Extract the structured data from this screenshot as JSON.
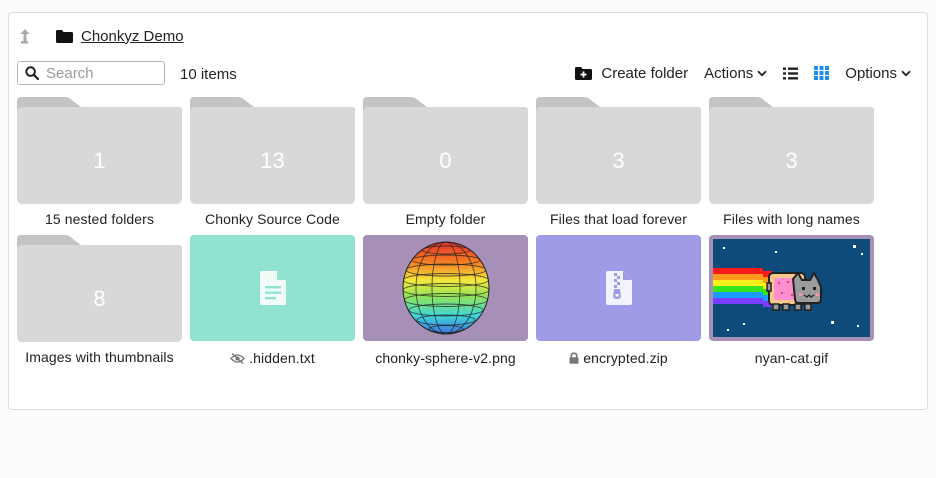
{
  "breadcrumb": {
    "label": "Chonkyz Demo"
  },
  "search": {
    "placeholder": "Search"
  },
  "item_count": "10 items",
  "toolbar": {
    "create_folder_label": "Create folder",
    "actions_label": "Actions",
    "options_label": "Options"
  },
  "colors": {
    "folder": "#d8d8d8",
    "txt_card": "#8fe3cf",
    "png_card": "#a690b8",
    "zip_card": "#9f9be6",
    "gif_card": "#a690b8",
    "grid_view_active": "#1f8eea"
  },
  "folders": [
    {
      "count": "1",
      "name": "15 nested folders"
    },
    {
      "count": "13",
      "name": "Chonky Source Code"
    },
    {
      "count": "0",
      "name": "Empty folder"
    },
    {
      "count": "3",
      "name": "Files that load forever"
    },
    {
      "count": "3",
      "name": "Files with long names"
    },
    {
      "count": "8",
      "name": "Images with thumbnails"
    }
  ],
  "files": [
    {
      "name": ".hidden.txt",
      "icon": "eye-slash-icon"
    },
    {
      "name": "chonky-sphere-v2.png",
      "icon": "sphere-thumbnail"
    },
    {
      "name": "encrypted.zip",
      "icon": "lock-icon"
    },
    {
      "name": "nyan-cat.gif",
      "icon": "nyan-cat-thumbnail"
    }
  ]
}
